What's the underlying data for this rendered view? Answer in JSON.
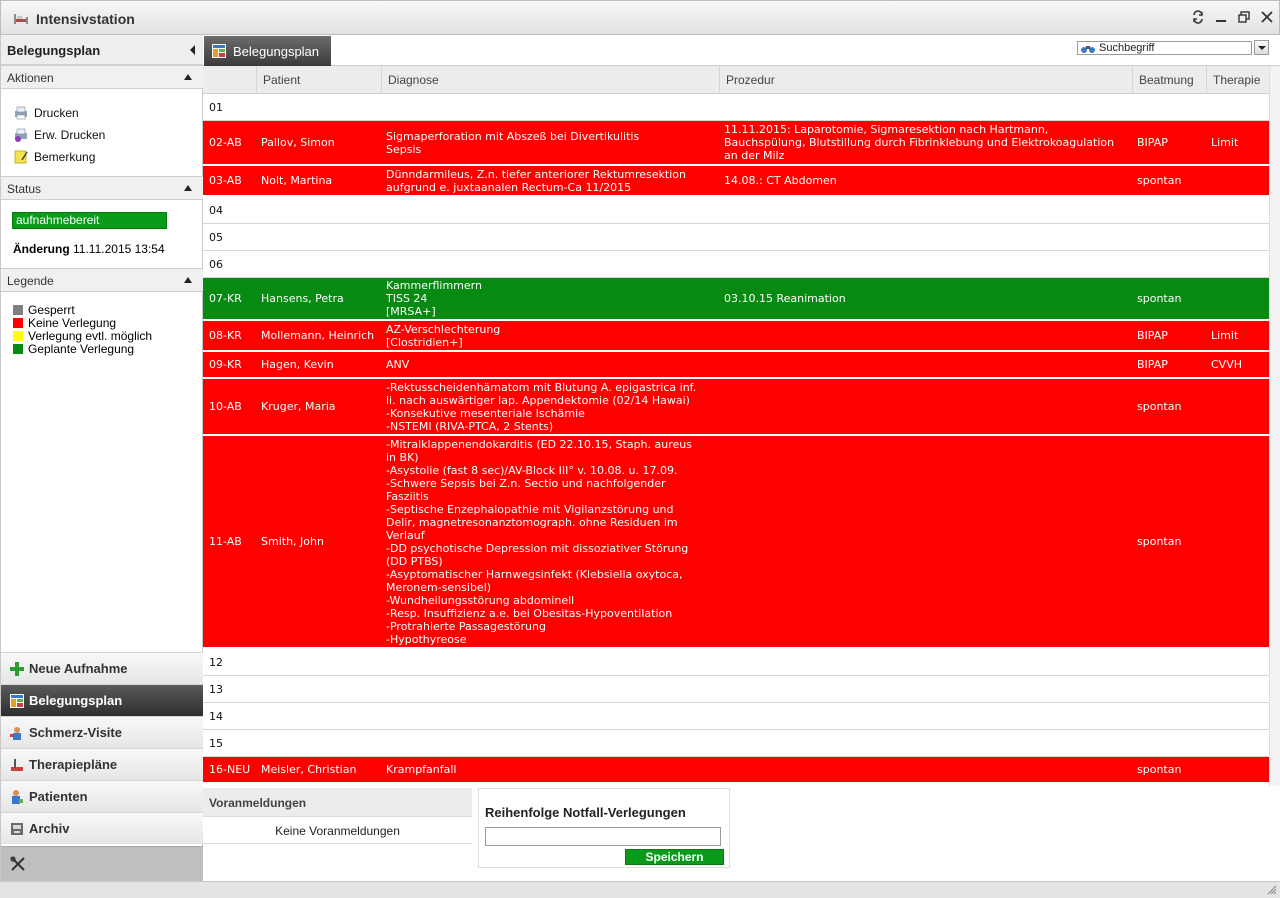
{
  "window": {
    "title": "Intensivstation",
    "icon": "bed-icon"
  },
  "sidebar": {
    "header": "Belegungsplan",
    "sections": {
      "aktionen": "Aktionen",
      "status": "Status",
      "legende": "Legende"
    },
    "actions": [
      {
        "label": "Drucken",
        "icon": "printer-icon"
      },
      {
        "label": "Erw. Drucken",
        "icon": "printer-extended-icon"
      },
      {
        "label": "Bemerkung",
        "icon": "note-icon"
      }
    ],
    "status": {
      "value": "aufnahmebereit",
      "change_label": "Änderung",
      "change_value": "11.11.2015 13:54"
    },
    "legend": [
      {
        "label": "Gesperrt",
        "color": "#808080"
      },
      {
        "label": "Keine Verlegung",
        "color": "#ff0000"
      },
      {
        "label": "Verlegung evtl. möglich",
        "color": "#ffff00"
      },
      {
        "label": "Geplante Verlegung",
        "color": "#078a12"
      }
    ],
    "nav": [
      {
        "label": "Neue Aufnahme",
        "icon": "plus-icon",
        "active": false
      },
      {
        "label": "Belegungsplan",
        "icon": "grid-icon",
        "active": true
      },
      {
        "label": "Schmerz-Visite",
        "icon": "pain-visit-icon",
        "active": false
      },
      {
        "label": "Therapiepläne",
        "icon": "therapy-icon",
        "active": false
      },
      {
        "label": "Patienten",
        "icon": "patients-icon",
        "active": false
      },
      {
        "label": "Archiv",
        "icon": "archive-icon",
        "active": false
      }
    ],
    "tools_icon": "tools-icon"
  },
  "main": {
    "tab": "Belegungsplan",
    "search": {
      "value": "Suchbegriff"
    },
    "columns": [
      "",
      "Patient",
      "Diagnose",
      "Prozedur",
      "Beatmung",
      "Therapie"
    ],
    "rows": [
      {
        "bed": "01",
        "patient": "",
        "diagnose": "",
        "prozedur": "",
        "beatmung": "",
        "therapie": "",
        "status": "white"
      },
      {
        "bed": "02-AB",
        "patient": "Pallov, Simon",
        "diagnose": "Sigmaperforation mit Abszeß bei Divertikulitis\nSepsis",
        "prozedur": "11.11.2015: Laparotomie, Sigmaresektion nach Hartmann,\nBauchspülung, Blutstillung durch Fibrinklebung und Elektrokoagulation\nan der Milz",
        "beatmung": "BIPAP",
        "therapie": "Limit",
        "status": "red"
      },
      {
        "bed": "03-AB",
        "patient": "Nolt, Martina",
        "diagnose": "Dünndarmileus, Z.n. tiefer anteriorer Rektumresektion\naufgrund e. juxtaanalen Rectum-Ca 11/2015",
        "prozedur": "14.08.: CT Abdomen",
        "beatmung": "spontan",
        "therapie": "",
        "status": "red"
      },
      {
        "bed": "04",
        "patient": "",
        "diagnose": "",
        "prozedur": "",
        "beatmung": "",
        "therapie": "",
        "status": "white"
      },
      {
        "bed": "05",
        "patient": "",
        "diagnose": "",
        "prozedur": "",
        "beatmung": "",
        "therapie": "",
        "status": "white"
      },
      {
        "bed": "06",
        "patient": "",
        "diagnose": "",
        "prozedur": "",
        "beatmung": "",
        "therapie": "",
        "status": "white"
      },
      {
        "bed": "07-KR",
        "patient": "Hansens, Petra",
        "diagnose": "Kammerflimmern\nTISS 24\n[MRSA+]",
        "prozedur": "03.10.15 Reanimation",
        "beatmung": "spontan",
        "therapie": "",
        "status": "green"
      },
      {
        "bed": "08-KR",
        "patient": "Mollemann, Heinrich",
        "diagnose": "AZ-Verschlechterung\n[Clostridien+]",
        "prozedur": "",
        "beatmung": "BIPAP",
        "therapie": "Limit",
        "status": "red"
      },
      {
        "bed": "09-KR",
        "patient": "Hagen, Kevin",
        "diagnose": "ANV",
        "prozedur": "",
        "beatmung": "BIPAP",
        "therapie": "CVVH",
        "status": "red"
      },
      {
        "bed": "10-AB",
        "patient": "Kruger, Maria",
        "diagnose": "-Rektusscheidenhämatom mit Blutung A. epigastrica inf.\nli. nach auswärtiger lap. Appendektomie (02/14 Hawai)\n-Konsekutive mesenteriale Ischämie\n-NSTEMI (RIVA-PTCA, 2 Stents)",
        "prozedur": "",
        "beatmung": "spontan",
        "therapie": "",
        "status": "red"
      },
      {
        "bed": "11-AB",
        "patient": "Smith, John",
        "diagnose": "-Mitralklappenendokarditis (ED 22.10.15, Staph. aureus\nin BK)\n-Asystolie (fast 8 sec)/AV-Block III° v. 10.08. u. 17.09.\n-Schwere Sepsis bei Z.n. Sectio und nachfolgender\nFasziitis\n-Septische Enzephalopathie mit Vigilanzstörung und\nDelir, magnetresonanztomograph. ohne Residuen im\nVerlauf\n-DD psychotische Depression mit dissoziativer Störung\n(DD PTBS)\n-Asyptomatischer Harnwegsinfekt (Klebsiella oxytoca,\nMeronem-sensibel)\n-Wundheilungsstörung abdominell\n-Resp. Insuffizienz a.e. bei Obesitas-Hypoventilation\n-Protrahierte Passagestörung\n-Hypothyreose",
        "prozedur": "",
        "beatmung": "spontan",
        "therapie": "",
        "status": "red"
      },
      {
        "bed": "12",
        "patient": "",
        "diagnose": "",
        "prozedur": "",
        "beatmung": "",
        "therapie": "",
        "status": "white"
      },
      {
        "bed": "13",
        "patient": "",
        "diagnose": "",
        "prozedur": "",
        "beatmung": "",
        "therapie": "",
        "status": "white"
      },
      {
        "bed": "14",
        "patient": "",
        "diagnose": "",
        "prozedur": "",
        "beatmung": "",
        "therapie": "",
        "status": "white"
      },
      {
        "bed": "15",
        "patient": "",
        "diagnose": "",
        "prozedur": "",
        "beatmung": "",
        "therapie": "",
        "status": "white"
      },
      {
        "bed": "16-NEU",
        "patient": "Meisler, Christian",
        "diagnose": "Krampfanfall",
        "prozedur": "",
        "beatmung": "spontan",
        "therapie": "",
        "status": "red"
      }
    ]
  },
  "voranmeldungen": {
    "title": "Voranmeldungen",
    "empty_text": "Keine Voranmeldungen"
  },
  "notfall": {
    "title": "Reihenfolge Notfall-Verlegungen",
    "input_value": "",
    "save_label": "Speichern"
  }
}
